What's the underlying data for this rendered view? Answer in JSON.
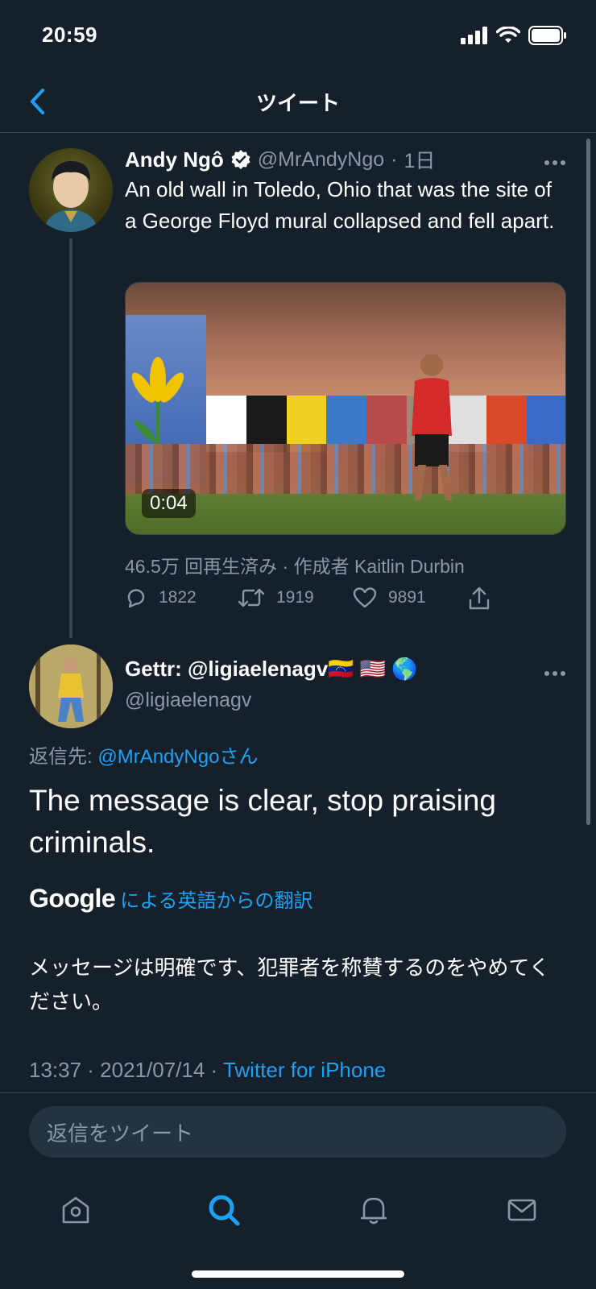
{
  "status_bar": {
    "time": "20:59",
    "icons": [
      "signal-icon",
      "wifi-icon",
      "battery-icon"
    ]
  },
  "nav": {
    "title": "ツイート",
    "back_icon": "chevron-left-icon"
  },
  "tweet1": {
    "name": "Andy Ngô",
    "verified": true,
    "handle": "@MrAndyNgo",
    "separator": "·",
    "time": "1日",
    "text": "An old wall in Toledo, Ohio that was the site of a George Floyd mural collapsed and fell apart.",
    "video_duration": "0:04",
    "views_line": "46.5万 回再生済み · 作成者 Kaitlin Durbin",
    "actions": {
      "replies": "1822",
      "retweets": "1919",
      "likes": "9891"
    }
  },
  "tweet2": {
    "name": "Gettr: @ligiaelenagv🇻🇪 🇺🇸 🌎",
    "handle": "@ligiaelenagv",
    "reply_prefix": "返信先: ",
    "reply_target": "@MrAndyNgoさん",
    "text": "The message is clear, stop praising criminals.",
    "google_label": "Google",
    "translate_label": "による英語からの翻訳",
    "translated_text": "メッセージは明確です、犯罪者を称賛するのをやめてください。",
    "timestamp": "13:37 · 2021/07/14 · ",
    "source": "Twitter for iPhone"
  },
  "reply_box": {
    "placeholder": "返信をツイート"
  },
  "tab_bar": {
    "active": "search",
    "tabs": [
      "home-icon",
      "search-icon",
      "bell-icon",
      "mail-icon"
    ]
  },
  "colors": {
    "background": "#15202b",
    "accent": "#1da1f2",
    "secondary_text": "#8899a6",
    "divider": "#38444d"
  }
}
